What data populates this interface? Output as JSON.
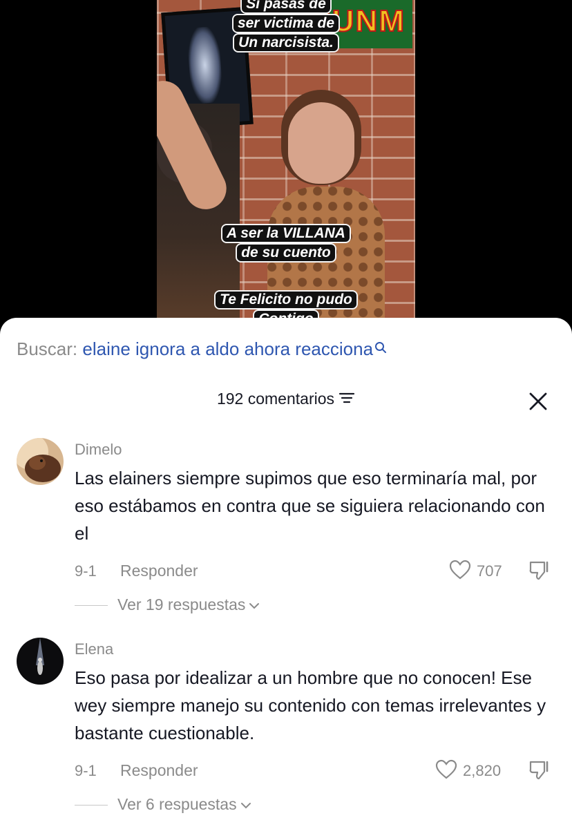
{
  "video": {
    "caption_top_1": "Si pasas de",
    "caption_top_2": "ser victima de",
    "caption_top_3": "Un narcisista.",
    "caption_mid_1": "A ser la VILLANA",
    "caption_mid_2": "de su cuento",
    "caption_bottom_1": "Te Felicito no pudo",
    "caption_bottom_2": "Contigo",
    "sign_text": "JUNM"
  },
  "search": {
    "label": "Buscar:",
    "query": "elaine ignora a aldo ahora reacciona"
  },
  "comments_header": {
    "count_label": "192 comentarios"
  },
  "comments": [
    {
      "username": "Dimelo",
      "text": "Las elainers siempre supimos que eso terminaría mal, por eso estábamos en contra que se siguiera relacionando con el",
      "date": "9-1",
      "reply_label": "Responder",
      "likes": "707",
      "view_replies": "Ver 19 respuestas"
    },
    {
      "username": "Elena",
      "text": "Eso pasa por idealizar a un hombre que no conocen! Ese wey siempre manejo su contenido con temas irrelevantes y bastante cuestionable.",
      "date": "9-1",
      "reply_label": "Responder",
      "likes": "2,820",
      "view_replies": "Ver 6 respuestas"
    }
  ],
  "colors": {
    "link_blue": "#2f57b0",
    "muted_gray": "#8a8a8a",
    "text_dark": "#161823"
  }
}
